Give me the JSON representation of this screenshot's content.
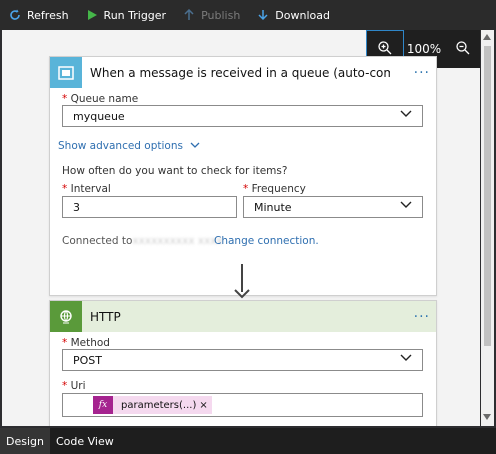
{
  "toolbar": {
    "refresh": "Refresh",
    "run_trigger": "Run Trigger",
    "publish": "Publish",
    "download": "Download"
  },
  "zoom": {
    "level": "100%"
  },
  "trigger_card": {
    "title": "When a message is received in a queue (auto-comple...",
    "queue_label": "Queue name",
    "queue_value": "myqueue",
    "show_advanced": "Show advanced options",
    "how_often": "How often do you want to check for items?",
    "interval_label": "Interval",
    "interval_value": "3",
    "frequency_label": "Frequency",
    "frequency_value": "Minute",
    "connected_prefix": "Connected to",
    "change_connection": "Change connection."
  },
  "http_card": {
    "title": "HTTP",
    "method_label": "Method",
    "method_value": "POST",
    "uri_label": "Uri",
    "token_fx": "fx",
    "token_text": "parameters(...)",
    "token_remove": "×"
  },
  "bottom_tabs": [
    "Design",
    "Code View"
  ],
  "colors": {
    "trigger_accent": "#59b4d9",
    "http_accent": "#5a9a3a",
    "link": "#2f6fb0",
    "token": "#a5238f"
  }
}
